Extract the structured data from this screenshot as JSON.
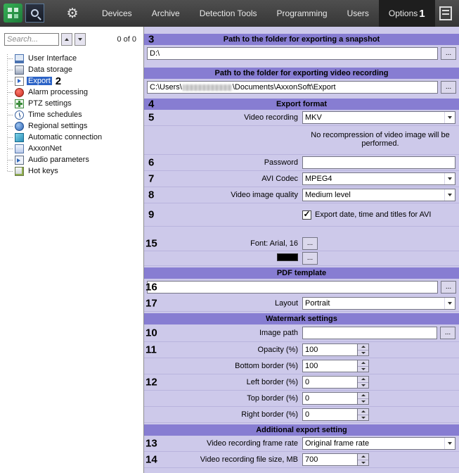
{
  "toolbar": {
    "menu": [
      {
        "label": "Devices"
      },
      {
        "label": "Archive"
      },
      {
        "label": "Detection Tools"
      },
      {
        "label": "Programming"
      },
      {
        "label": "Users"
      },
      {
        "label": "Options"
      }
    ],
    "active": "Options"
  },
  "sidebar": {
    "search_placeholder": "Search...",
    "counter": "0 of 0",
    "items": [
      {
        "label": "User Interface",
        "icon": "monitor-icon"
      },
      {
        "label": "Data storage",
        "icon": "storage-icon"
      },
      {
        "label": "Export",
        "icon": "export-icon",
        "selected": true
      },
      {
        "label": "Alarm processing",
        "icon": "alarm-icon"
      },
      {
        "label": "PTZ settings",
        "icon": "ptz-icon"
      },
      {
        "label": "Time schedules",
        "icon": "clock-icon"
      },
      {
        "label": "Regional settings",
        "icon": "globe-icon"
      },
      {
        "label": "Automatic connection",
        "icon": "connection-icon"
      },
      {
        "label": "AxxonNet",
        "icon": "axxonnet-icon"
      },
      {
        "label": "Audio parameters",
        "icon": "speaker-icon"
      },
      {
        "label": "Hot keys",
        "icon": "keyboard-icon"
      }
    ]
  },
  "panel": {
    "header_snapshot": "Path to the folder for exporting a snapshot",
    "snapshot_path": "D:\\",
    "header_video_path": "Path to the folder for exporting video recording",
    "video_path_prefix": "C:\\Users\\",
    "video_path_redacted": true,
    "video_path_suffix": "\\Documents\\AxxonSoft\\Export",
    "header_format": "Export format",
    "video_recording_label": "Video recording",
    "video_recording_value": "MKV",
    "format_note": "No recompression of video image will be performed.",
    "password_label": "Password",
    "password_value": "",
    "avi_codec_label": "AVI Codec",
    "avi_codec_value": "MPEG4",
    "quality_label": "Video image quality",
    "quality_value": "Medium level",
    "avi_titles_label": "Export date, time and titles for AVI",
    "avi_titles_checked": true,
    "font_label": "Font: Arial, 16",
    "font_color": "#000000",
    "header_pdf": "PDF template",
    "pdf_template_value": "",
    "layout_label": "Layout",
    "layout_value": "Portrait",
    "header_watermark": "Watermark settings",
    "image_path_label": "Image path",
    "image_path_value": "",
    "spinners": [
      {
        "label": "Opacity (%)",
        "value": "100"
      },
      {
        "label": "Bottom border (%)",
        "value": "100"
      },
      {
        "label": "Left border (%)",
        "value": "0"
      },
      {
        "label": "Top border (%)",
        "value": "0"
      },
      {
        "label": "Right border (%)",
        "value": "0"
      }
    ],
    "header_additional": "Additional export setting",
    "frame_rate_label": "Video recording frame rate",
    "frame_rate_value": "Original frame rate",
    "file_size_label": "Video recording file size, MB",
    "file_size_value": "700"
  },
  "ui": {
    "ellipsis": "..."
  },
  "colors": {
    "accent_header": "#877dd2",
    "panel_bg": "#cdc9ea",
    "selection_blue": "#2c63c6"
  },
  "annotations": {
    "n1": "1",
    "n2": "2",
    "n3": "3",
    "n4": "4",
    "n5": "5",
    "n6": "6",
    "n7": "7",
    "n8": "8",
    "n9": "9",
    "n10": "10",
    "n11": "11",
    "n12": "12",
    "n13": "13",
    "n14": "14",
    "n15": "15",
    "n16": "16",
    "n17": "17"
  }
}
